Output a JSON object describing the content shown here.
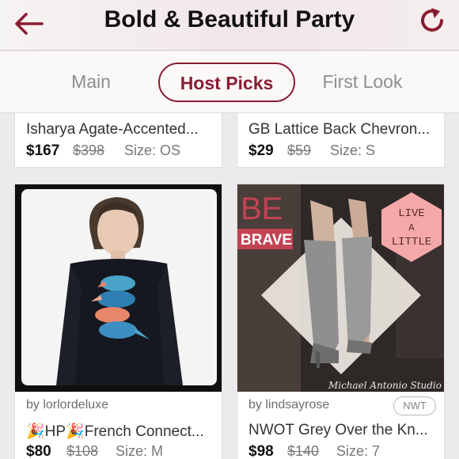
{
  "header": {
    "title": "Bold & Beautiful Party",
    "back_icon": "arrow-left-icon",
    "refresh_icon": "refresh-icon",
    "accent_color": "#8a1c32"
  },
  "tabs": [
    {
      "label": "Main",
      "active": false
    },
    {
      "label": "Host Picks",
      "active": true
    },
    {
      "label": "First Look",
      "active": false
    }
  ],
  "listings": [
    {
      "title": "Isharya Agate-Accented...",
      "price": "$167",
      "original_price": "$398",
      "size": "Size: OS"
    },
    {
      "title": "GB Lattice Back Chevron...",
      "price": "$29",
      "original_price": "$59",
      "size": "Size: S"
    },
    {
      "seller": "by lorlordeluxe",
      "title": "🎉HP🎉French Connect...",
      "price": "$80",
      "original_price": "$108",
      "size": "Size: M"
    },
    {
      "seller": "by lindsayrose",
      "badge": "NWT",
      "title": "NWOT Grey Over the Kn...",
      "price": "$98",
      "original_price": "$140",
      "size": "Size: 7",
      "image_text": {
        "be": "BE",
        "brave": "BRAVE",
        "live": "LIVE",
        "a": "A",
        "little": "LITTLE",
        "watermark": "Michael Antonio Studio"
      }
    }
  ]
}
